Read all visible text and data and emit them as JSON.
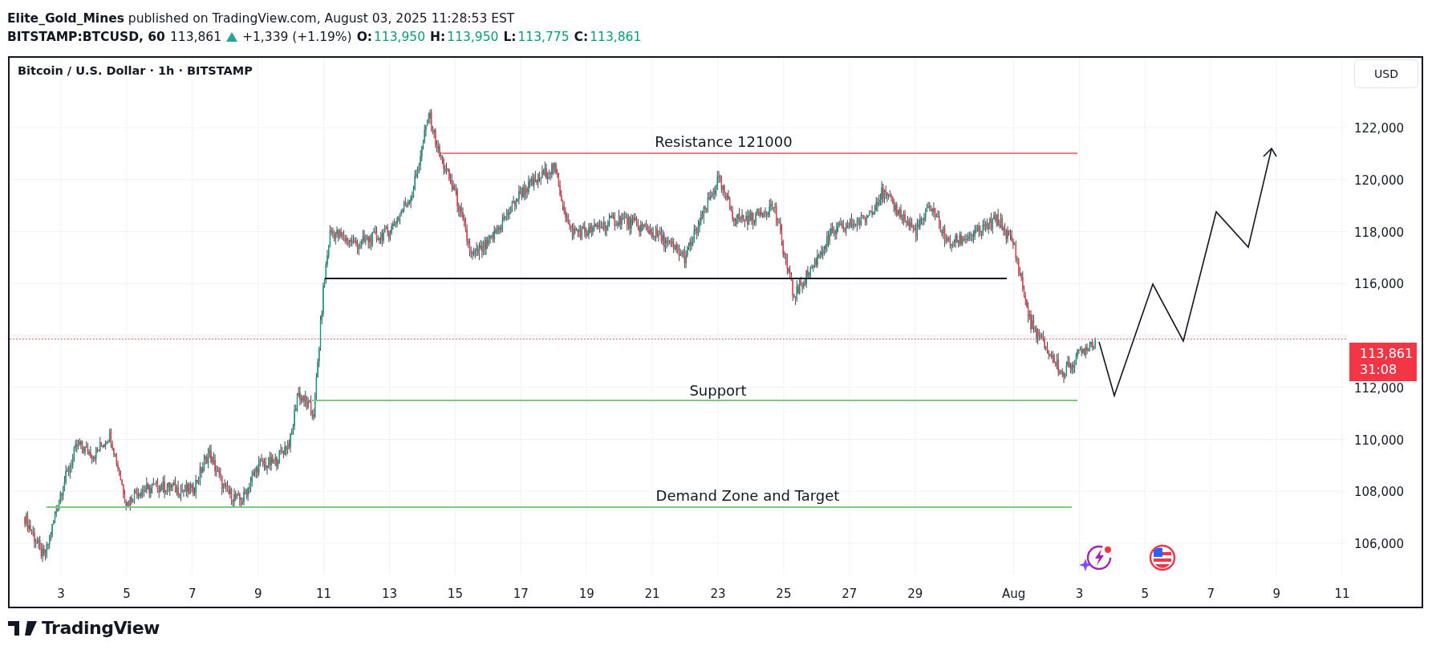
{
  "header": {
    "byline": "**Elite_Gold_Mines** published on TradingView.com, August 03, 2025 11:28:53 EST",
    "symbol": "BITSTAMP:BTCUSD, 60",
    "last": "113,861",
    "change": "+1,339 (+1.19%)",
    "ohlc": [
      {
        "label": "O:",
        "value": "113,950"
      },
      {
        "label": "H:",
        "value": "113,950"
      },
      {
        "label": "L:",
        "value": "113,775"
      },
      {
        "label": "C:",
        "value": "113,861"
      }
    ]
  },
  "chart": {
    "title": "Bitcoin / U.S. Dollar · 1h · BITSTAMP",
    "currency_button": "USD",
    "price_axis": [
      "122,000",
      "120,000",
      "118,000",
      "116,000",
      "112,000",
      "110,000",
      "108,000",
      "106,000"
    ],
    "time_axis": [
      "3",
      "5",
      "7",
      "9",
      "11",
      "13",
      "15",
      "17",
      "19",
      "21",
      "23",
      "25",
      "27",
      "29",
      "Aug",
      "3",
      "5",
      "7",
      "9",
      "11"
    ],
    "last_price": {
      "value": "113,861",
      "countdown": "31:08"
    },
    "annotations": [
      {
        "kind": "hline",
        "label": "Resistance 121000",
        "color": "#f77c80"
      },
      {
        "kind": "hline",
        "color": "#131722"
      },
      {
        "kind": "hline",
        "label": "Support",
        "color": "#81c784"
      },
      {
        "kind": "hline",
        "label": "Demand Zone and Target",
        "color": "#81c784"
      },
      {
        "kind": "arrow",
        "color": "#131722"
      }
    ]
  },
  "footer": {
    "brand": "TradingView"
  }
}
